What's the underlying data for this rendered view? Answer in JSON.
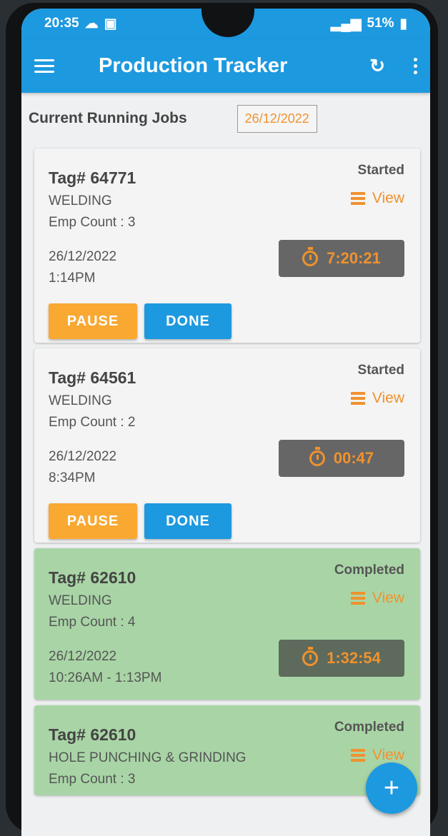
{
  "status_bar": {
    "time": "20:35",
    "battery": "51%"
  },
  "app_bar": {
    "title": "Production Tracker"
  },
  "header": {
    "label": "Current Running Jobs",
    "date": "26/12/2022"
  },
  "jobs": [
    {
      "tag": "Tag# 64771",
      "operation": "WELDING",
      "emp_count": "Emp Count : 3",
      "date": "26/12/2022",
      "time": "1:14PM",
      "status": "Started",
      "view_label": "View",
      "timer": "7:20:21",
      "pause_label": "PAUSE",
      "done_label": "DONE"
    },
    {
      "tag": "Tag# 64561",
      "operation": "WELDING",
      "emp_count": "Emp Count : 2",
      "date": "26/12/2022",
      "time": "8:34PM",
      "status": "Started",
      "view_label": "View",
      "timer": "00:47",
      "pause_label": "PAUSE",
      "done_label": "DONE"
    },
    {
      "tag": "Tag# 62610",
      "operation": "WELDING",
      "emp_count": "Emp Count : 4",
      "date": "26/12/2022",
      "time": "10:26AM - 1:13PM",
      "status": "Completed",
      "view_label": "View",
      "timer": "1:32:54"
    },
    {
      "tag": "Tag# 62610",
      "operation": "HOLE PUNCHING & GRINDING",
      "emp_count": "Emp Count : 3",
      "status": "Completed",
      "view_label": "View"
    }
  ],
  "fab": {
    "label": "+"
  },
  "colors": {
    "primary": "#1d99df",
    "accent": "#f0922e",
    "pause": "#f9a832",
    "completed_card": "#a9d5a6"
  }
}
